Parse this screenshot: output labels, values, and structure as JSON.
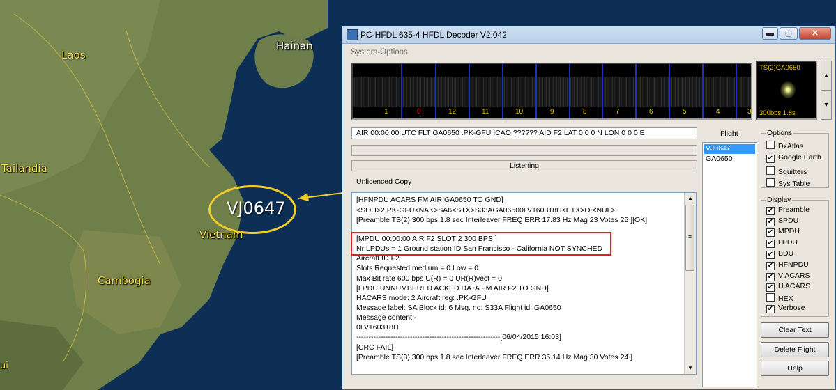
{
  "map": {
    "labels": {
      "laos": "Laos",
      "hainan": "Hainan",
      "tailandia": "Tailandia",
      "vietnam": "Vietnam",
      "cambogia": "Cambogia",
      "edge": "ui"
    },
    "callout_label": "VJ0647",
    "colors": {
      "sea": "#0d2f55",
      "land": "#6f7f4a",
      "label": "#f4e04a",
      "annotation": "#f2cc2a",
      "highlight": "#e11f26"
    }
  },
  "window": {
    "title": "PC-HFDL 635-4 HFDL Decoder V2.042",
    "controls": {
      "minimize": "▬",
      "maximize": "▢",
      "close": "✕"
    },
    "menu": "System-Options"
  },
  "waterfall": {
    "channels": [
      "1",
      "0",
      "12",
      "11",
      "10",
      "9",
      "8",
      "7",
      "6",
      "5",
      "4",
      "3"
    ],
    "active_channel_color": "#e2331b"
  },
  "scope": {
    "title": "TS(2)GA0650",
    "footer": "300bps 1.8s"
  },
  "spin": {
    "up": "▲",
    "down": "▼"
  },
  "status_line": "AIR 00:00:00  UTC FLT GA0650 .PK-GFU ICAO ?????? AID F2 LAT 0 0 0  N  LON 0 0 0  E",
  "listening": "Listening",
  "license": "Unlicenced Copy",
  "messages": [
    "[HFNPDU ACARS FM AIR GA0650 TO GND]",
    "<SOH>2.PK-GFU<NAK>SA6<STX>S33AGA06500LV160318H<ETX>O:<NUL>",
    "[Preamble TS(2) 300  bps 1.8 sec Interleaver FREQ ERR 17.83 Hz Mag 23 Votes 25 ][OK]",
    "",
    "[MPDU 00:00:00 AIR F2 SLOT 2 300 BPS ]",
    "Nr LPDUs = 1 Ground station ID San Francisco - California NOT SYNCHED",
    "Aircraft ID F2",
    "Slots Requested medium = 0 Low = 0",
    "Max Bit rate 600 bps U(R) = 0 UR(R)vect = 0",
    "[LPDU UNNUMBERED ACKED DATA FM AIR F2 TO GND]",
    "HACARS mode: 2  Aircraft reg: .PK-GFU",
    "Message label: SA  Block id: 6  Msg. no: S33A Flight id: GA0650",
    "Message content:-",
    "0LV160318H",
    "-----------------------------------------------------------[06/04/2015 16:03]",
    "[CRC FAIL]",
    "[Preamble TS(3) 300  bps 1.8 sec Interleaver FREQ ERR 35.14 Hz Mag 30 Votes 24 ]"
  ],
  "scroll": {
    "up": "▲",
    "down": "▼",
    "grip": "≡"
  },
  "flights": {
    "label": "Flight",
    "items": [
      "VJ0647",
      "GA0650"
    ],
    "selected": "VJ0647"
  },
  "options": {
    "title": "Options",
    "items": [
      {
        "label": "DxAtlas",
        "checked": false
      },
      {
        "label": "Google Earth",
        "checked": true
      },
      {
        "label": "Squitters",
        "checked": false
      },
      {
        "label": "Sys Table",
        "checked": false
      }
    ]
  },
  "display": {
    "title": "Display",
    "items": [
      {
        "label": "Preamble",
        "checked": true
      },
      {
        "label": "SPDU",
        "checked": true
      },
      {
        "label": "MPDU",
        "checked": true
      },
      {
        "label": "LPDU",
        "checked": true
      },
      {
        "label": "BDU",
        "checked": true
      },
      {
        "label": "HFNPDU",
        "checked": true
      },
      {
        "label": "V ACARS",
        "checked": true
      },
      {
        "label": "H ACARS",
        "checked": true
      },
      {
        "label": "HEX",
        "checked": false
      },
      {
        "label": "Verbose",
        "checked": true
      }
    ]
  },
  "buttons": {
    "clear_text": "Clear Text",
    "delete_flight": "Delete Flight",
    "help": "Help"
  }
}
